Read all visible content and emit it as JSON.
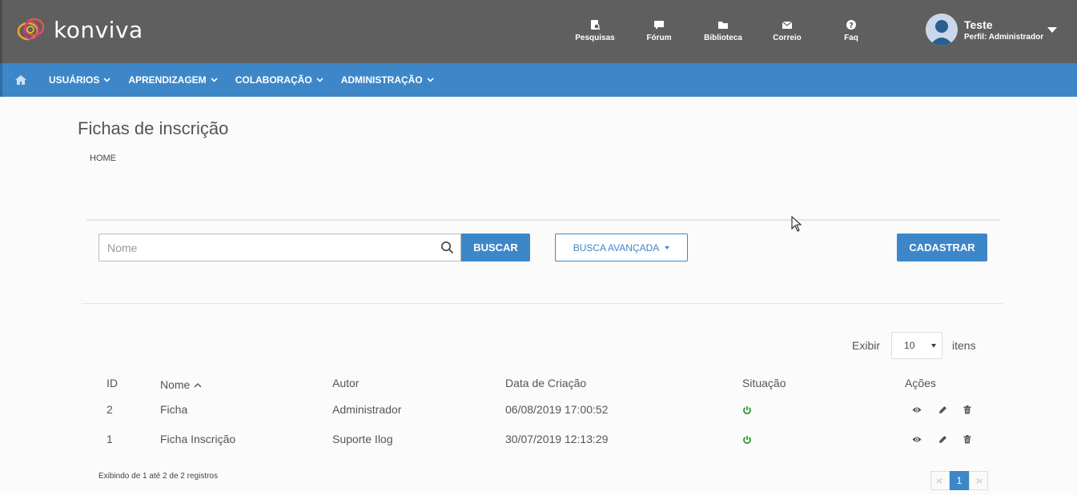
{
  "brand": {
    "name": "konviva"
  },
  "topnav": [
    {
      "label": "Pesquisas",
      "icon": "survey-icon"
    },
    {
      "label": "Fórum",
      "icon": "forum-icon"
    },
    {
      "label": "Biblioteca",
      "icon": "folder-icon"
    },
    {
      "label": "Correio",
      "icon": "mail-icon"
    },
    {
      "label": "Faq",
      "icon": "question-icon"
    }
  ],
  "profile": {
    "name": "Teste",
    "role": "Perfil: Administrador"
  },
  "menu": [
    {
      "label": "USUÁRIOS"
    },
    {
      "label": "APRENDIZAGEM"
    },
    {
      "label": "COLABORAÇÃO"
    },
    {
      "label": "ADMINISTRAÇÃO"
    }
  ],
  "page": {
    "title": "Fichas de inscrição",
    "breadcrumb": "HOME"
  },
  "search": {
    "placeholder": "Nome",
    "value": "",
    "button": "BUSCAR",
    "advanced": "BUSCA AVANÇADA",
    "create": "CADASTRAR"
  },
  "paging": {
    "show_label": "Exibir",
    "per_page": "10",
    "items_label": "itens",
    "summary": "Exibindo de 1 até 2 de 2 registros",
    "current_page": "1"
  },
  "table": {
    "headers": {
      "id": "ID",
      "nome": "Nome",
      "autor": "Autor",
      "data": "Data de Criação",
      "situacao": "Situação",
      "acoes": "Ações"
    },
    "rows": [
      {
        "id": "2",
        "nome": "Ficha",
        "autor": "Administrador",
        "data": "06/08/2019 17:00:52",
        "situacao": "active"
      },
      {
        "id": "1",
        "nome": "Ficha Inscrição",
        "autor": "Suporte Ilog",
        "data": "30/07/2019 12:13:29",
        "situacao": "active"
      }
    ]
  },
  "colors": {
    "header": "#5f5f5f",
    "menu": "#3d87c9",
    "status_active": "#2e9e2e"
  }
}
